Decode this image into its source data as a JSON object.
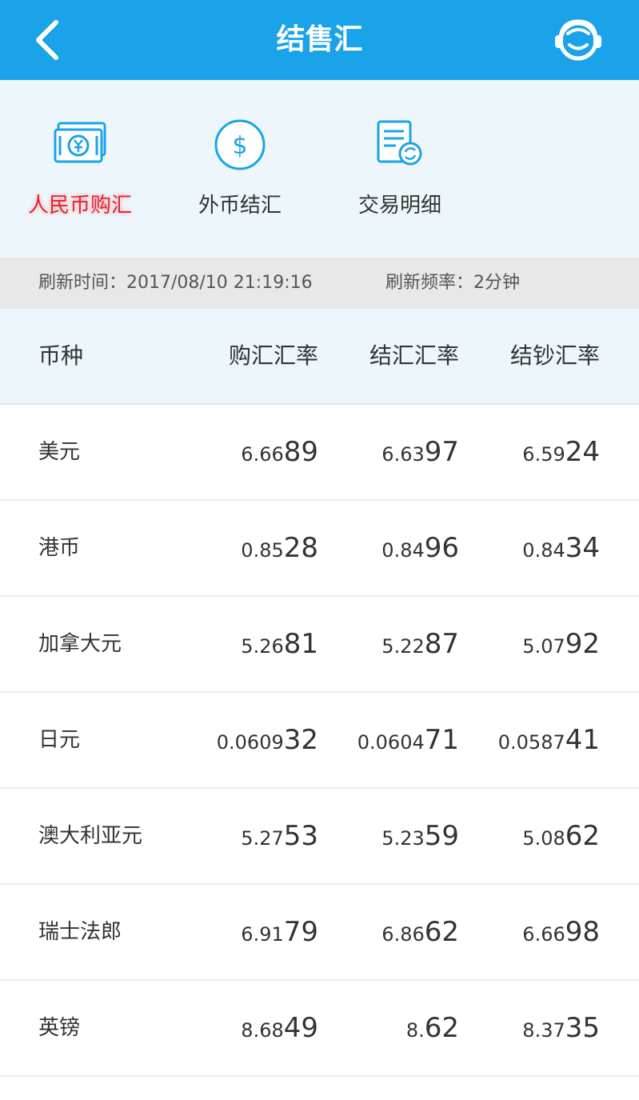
{
  "header": {
    "title": "结售汇"
  },
  "menu": [
    {
      "label": "人民币购汇",
      "active": true
    },
    {
      "label": "外币结汇",
      "active": false
    },
    {
      "label": "交易明细",
      "active": false
    }
  ],
  "refresh": {
    "time_text": "刷新时间：2017/08/10 21:19:16",
    "freq_text": "刷新频率：2分钟"
  },
  "table": {
    "headers": [
      "币种",
      "购汇汇率",
      "结汇汇率",
      "结钞汇率"
    ],
    "rows": [
      {
        "currency": "美元",
        "rates": [
          {
            "lead": "6.66",
            "tail": "89"
          },
          {
            "lead": "6.63",
            "tail": "97"
          },
          {
            "lead": "6.59",
            "tail": "24"
          }
        ]
      },
      {
        "currency": "港币",
        "rates": [
          {
            "lead": "0.85",
            "tail": "28"
          },
          {
            "lead": "0.84",
            "tail": "96"
          },
          {
            "lead": "0.84",
            "tail": "34"
          }
        ]
      },
      {
        "currency": "加拿大元",
        "rates": [
          {
            "lead": "5.26",
            "tail": "81"
          },
          {
            "lead": "5.22",
            "tail": "87"
          },
          {
            "lead": "5.07",
            "tail": "92"
          }
        ]
      },
      {
        "currency": "日元",
        "rates": [
          {
            "lead": "0.0609",
            "tail": "32"
          },
          {
            "lead": "0.0604",
            "tail": "71"
          },
          {
            "lead": "0.0587",
            "tail": "41"
          }
        ]
      },
      {
        "currency": "澳大利亚元",
        "rates": [
          {
            "lead": "5.27",
            "tail": "53"
          },
          {
            "lead": "5.23",
            "tail": "59"
          },
          {
            "lead": "5.08",
            "tail": "62"
          }
        ]
      },
      {
        "currency": "瑞士法郎",
        "rates": [
          {
            "lead": "6.91",
            "tail": "79"
          },
          {
            "lead": "6.86",
            "tail": "62"
          },
          {
            "lead": "6.66",
            "tail": "98"
          }
        ]
      },
      {
        "currency": "英镑",
        "rates": [
          {
            "lead": "8.68",
            "tail": "49"
          },
          {
            "lead": "8.",
            "tail": "62"
          },
          {
            "lead": "8.37",
            "tail": "35"
          }
        ]
      }
    ]
  },
  "colors": {
    "header_bg": "#1aa3e8",
    "icon_blue": "#1aa3e8",
    "active_label": "#e8232e"
  }
}
